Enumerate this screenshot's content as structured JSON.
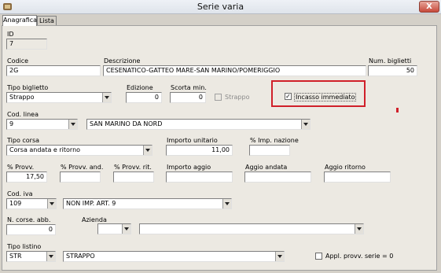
{
  "window": {
    "title": "Serie varia",
    "close_glyph": "X"
  },
  "tabs": [
    {
      "label": "Anagrafica"
    },
    {
      "label": "Lista"
    }
  ],
  "fields": {
    "id": {
      "label": "ID",
      "value": "7"
    },
    "codice": {
      "label": "Codice",
      "value": "2G"
    },
    "descrizione": {
      "label": "Descrizione",
      "value": "CESENATICO-GATTEO MARE-SAN MARINO/POMERIGGIO"
    },
    "num_biglietti": {
      "label": "Num. biglietti",
      "value": "50"
    },
    "tipo_biglietto": {
      "label": "Tipo biglietto",
      "value": "Strappo"
    },
    "edizione": {
      "label": "Edizione",
      "value": "0"
    },
    "scorta_min": {
      "label": "Scorta min.",
      "value": "0"
    },
    "strappo": {
      "label": "Strappo",
      "checked": false,
      "enabled": false
    },
    "incasso_immediato": {
      "label": "Incasso immediato",
      "checked": true,
      "check_glyph": "✓"
    },
    "cod_linea": {
      "label": "Cod. linea",
      "value": "9",
      "description": "SAN MARINO DA NORD"
    },
    "tipo_corsa": {
      "label": "Tipo corsa",
      "value": "Corsa andata e ritorno"
    },
    "importo_unitario": {
      "label": "Importo unitario",
      "value": "11,00"
    },
    "imp_nazione": {
      "label": "% Imp. nazione",
      "value": ""
    },
    "provv": {
      "label": "% Provv.",
      "value": "17,50"
    },
    "provv_and": {
      "label": "% Provv. and.",
      "value": ""
    },
    "provv_rit": {
      "label": "% Provv. rit.",
      "value": ""
    },
    "importo_aggio": {
      "label": "Importo aggio",
      "value": ""
    },
    "aggio_andata": {
      "label": "Aggio andata",
      "value": ""
    },
    "aggio_ritorno": {
      "label": "Aggio ritorno",
      "value": ""
    },
    "cod_iva": {
      "label": "Cod. iva",
      "value": "109",
      "description": "NON IMP. ART. 9"
    },
    "n_corse_abb": {
      "label": "N. corse. abb.",
      "value": "0"
    },
    "azienda": {
      "label": "Azienda",
      "value": "",
      "description": ""
    },
    "tipo_listino": {
      "label": "Tipo listino",
      "value": "STR",
      "description": "STRAPPO"
    },
    "appl_provv": {
      "label": "Appl. provv. serie = 0",
      "checked": false
    }
  },
  "colors": {
    "highlight": "#d0202a",
    "panel": "#ece9e2",
    "window": "#d4d0c8"
  },
  "icons": {
    "app": "app-icon",
    "dropdown": "chevron-down-icon"
  }
}
